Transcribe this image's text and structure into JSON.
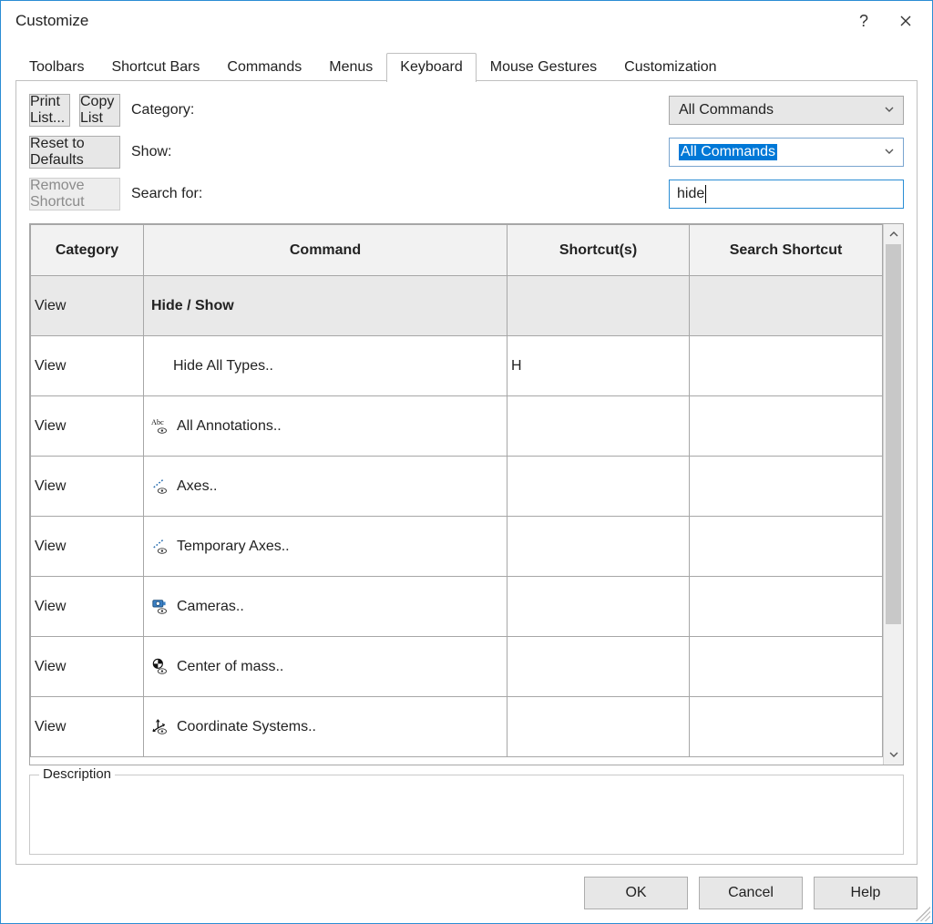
{
  "window": {
    "title": "Customize"
  },
  "tabs": {
    "toolbars": "Toolbars",
    "shortcut_bars": "Shortcut Bars",
    "commands": "Commands",
    "menus": "Menus",
    "keyboard": "Keyboard",
    "mouse_gestures": "Mouse Gestures",
    "customization": "Customization"
  },
  "labels": {
    "category": "Category:",
    "show": "Show:",
    "search_for": "Search for:",
    "description": "Description"
  },
  "dropdowns": {
    "category_value": "All Commands",
    "show_value": "All Commands"
  },
  "search": {
    "value": "hide"
  },
  "buttons": {
    "print_list": "Print List...",
    "copy_list": "Copy List",
    "reset_defaults": "Reset to Defaults",
    "remove_shortcut": "Remove Shortcut",
    "ok": "OK",
    "cancel": "Cancel",
    "help": "Help"
  },
  "table": {
    "headers": {
      "category": "Category",
      "command": "Command",
      "shortcuts": "Shortcut(s)",
      "search_shortcut": "Search Shortcut"
    },
    "rows": [
      {
        "group": true,
        "category": "View",
        "command": "Hide / Show",
        "shortcut": "",
        "icon": ""
      },
      {
        "group": false,
        "category": "View",
        "command": "Hide All Types..",
        "shortcut": "H",
        "icon": "",
        "indent": true
      },
      {
        "group": false,
        "category": "View",
        "command": "All Annotations..",
        "shortcut": "",
        "icon": "abc-eye"
      },
      {
        "group": false,
        "category": "View",
        "command": "Axes..",
        "shortcut": "",
        "icon": "axes-eye"
      },
      {
        "group": false,
        "category": "View",
        "command": "Temporary Axes..",
        "shortcut": "",
        "icon": "axes-eye"
      },
      {
        "group": false,
        "category": "View",
        "command": "Cameras..",
        "shortcut": "",
        "icon": "camera-eye"
      },
      {
        "group": false,
        "category": "View",
        "command": "Center of mass..",
        "shortcut": "",
        "icon": "com-eye"
      },
      {
        "group": false,
        "category": "View",
        "command": "Coordinate Systems..",
        "shortcut": "",
        "icon": "csys-eye"
      }
    ]
  }
}
